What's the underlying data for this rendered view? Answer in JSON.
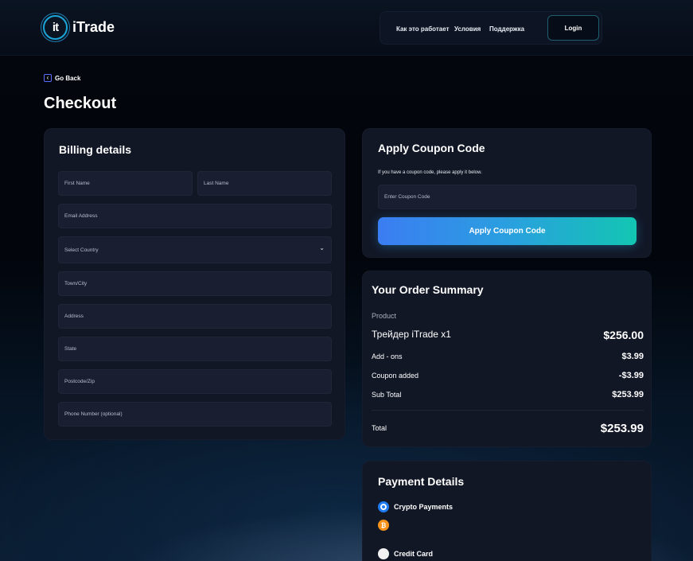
{
  "app": {
    "name": "iTrade",
    "logo_mark": "it"
  },
  "nav": {
    "links": [
      "Как это работает",
      "Условия",
      "Поддержка"
    ],
    "login_label": "Login"
  },
  "page": {
    "back_label": "Go Back",
    "title": "Checkout"
  },
  "billing": {
    "title": "Billing details",
    "fields": {
      "first_name": "First Name",
      "last_name": "Last Name",
      "email": "Email Address",
      "country": "Select Country",
      "town": "Town/City",
      "address": "Address",
      "state": "State",
      "postcode": "Postcode/Zip",
      "phone": "Phone Number (optional)"
    }
  },
  "coupon": {
    "title": "Apply Coupon Code",
    "description": "If you have a coupon code, please apply it below.",
    "placeholder": "Enter Coupon Code",
    "button_label": "Apply Coupon Code"
  },
  "summary": {
    "title": "Your Order Summary",
    "product_header": "Product",
    "product_name": "Трейдер iTrade  x1",
    "product_price": "$256.00",
    "addons_label": "Add - ons",
    "addons_value": "$3.99",
    "coupon_label": "Coupon added",
    "coupon_value": "-$3.99",
    "subtotal_label": "Sub Total",
    "subtotal_value": "$253.99",
    "total_label": "Total",
    "total_value": "$253.99"
  },
  "payment": {
    "title": "Payment Details",
    "crypto_label": "Crypto Payments",
    "crypto_selected": true,
    "btc_glyph": "₿",
    "card_label": "Credit Card"
  },
  "colors": {
    "accent_blue": "#3b7df2",
    "accent_teal": "#12c6b2",
    "bitcoin": "#f7931a",
    "card_bg": "#121726"
  }
}
